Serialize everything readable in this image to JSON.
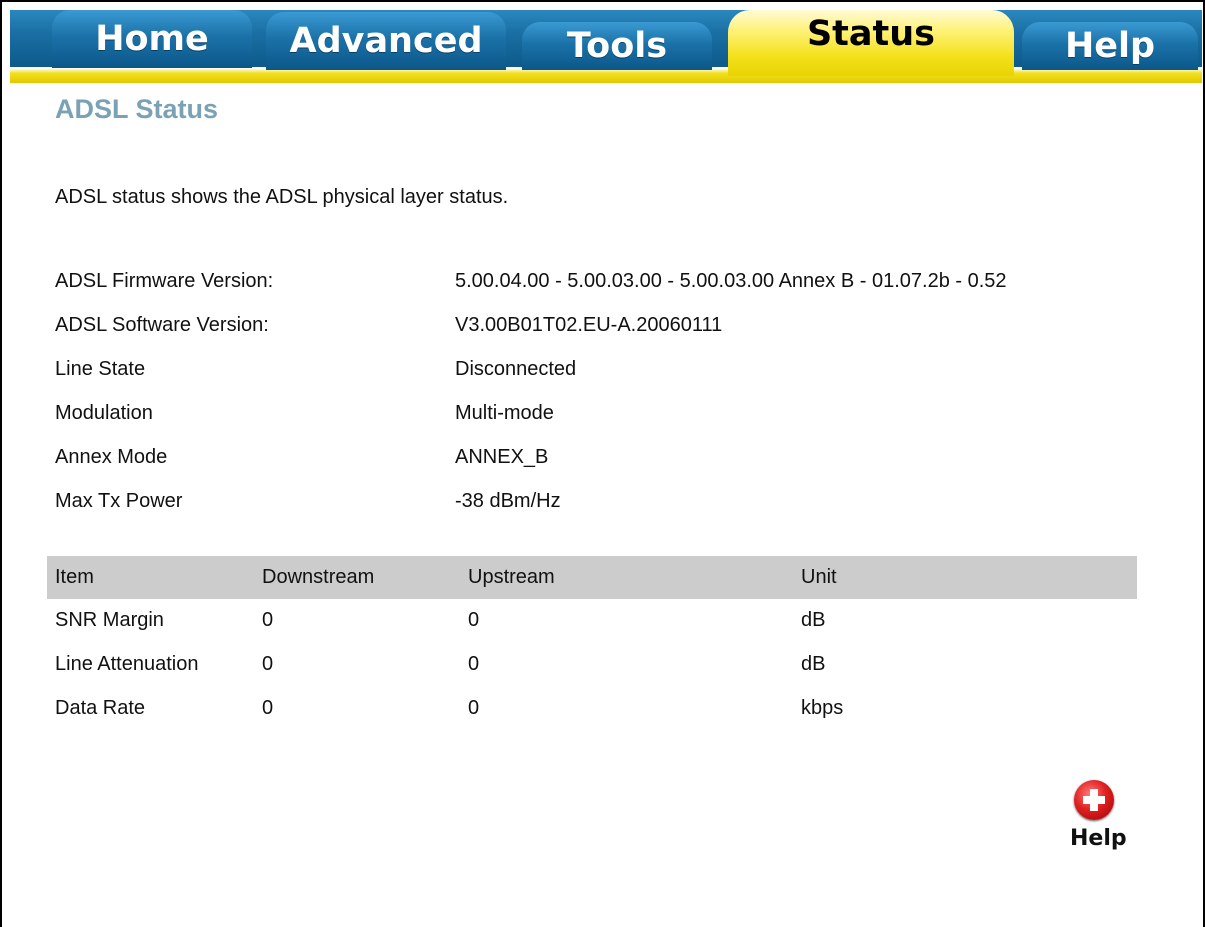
{
  "tabs": [
    {
      "id": "home",
      "label": "Home"
    },
    {
      "id": "advanced",
      "label": "Advanced"
    },
    {
      "id": "tools",
      "label": "Tools"
    },
    {
      "id": "status",
      "label": "Status",
      "active": true
    },
    {
      "id": "help",
      "label": "Help"
    }
  ],
  "page": {
    "title": "ADSL Status",
    "description": "ADSL status shows the ADSL physical layer status."
  },
  "info": [
    {
      "label": "ADSL Firmware Version:",
      "value": "5.00.04.00 - 5.00.03.00 - 5.00.03.00 Annex B - 01.07.2b - 0.52"
    },
    {
      "label": "ADSL Software Version:",
      "value": "V3.00B01T02.EU-A.20060111"
    },
    {
      "label": "Line State",
      "value": "Disconnected"
    },
    {
      "label": "Modulation",
      "value": "Multi-mode"
    },
    {
      "label": "Annex Mode",
      "value": "ANNEX_B"
    },
    {
      "label": "Max Tx Power",
      "value": "-38 dBm/Hz"
    }
  ],
  "stats": {
    "headers": [
      "Item",
      "Downstream",
      "Upstream",
      "Unit"
    ],
    "rows": [
      [
        "SNR Margin",
        "0",
        "0",
        "dB"
      ],
      [
        "Line Attenuation",
        "0",
        "0",
        "dB"
      ],
      [
        "Data Rate",
        "0",
        "0",
        "kbps"
      ]
    ]
  },
  "help_button": {
    "label": "Help",
    "icon": "plus-circle-icon"
  },
  "colors": {
    "tab_blue": "#1b72a8",
    "tab_active_yellow": "#f4e11d",
    "title": "#7aa2b4",
    "table_header": "#cccccc",
    "help_red": "#e02020"
  }
}
